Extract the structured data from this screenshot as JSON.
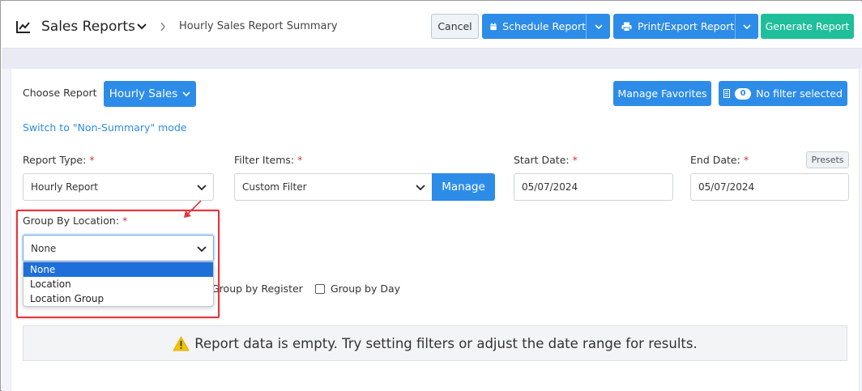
{
  "header": {
    "title": "Sales Reports",
    "breadcrumb": "Hourly Sales Report Summary",
    "cancel_label": "Cancel",
    "schedule_label": "Schedule Report",
    "print_label": "Print/Export Report",
    "generate_label": "Generate Report"
  },
  "toolbar": {
    "choose_label": "Choose Report",
    "report_button": "Hourly Sales",
    "favorites_button": "Manage Favorites",
    "filter_count": "0",
    "filter_label": "No filter selected",
    "mode_link": "Switch to \"Non-Summary\" mode"
  },
  "form": {
    "report_type": {
      "label": "Report Type:",
      "required": "*",
      "value": "Hourly Report"
    },
    "filter_items": {
      "label": "Filter Items:",
      "required": "*",
      "value": "Custom Filter",
      "manage_label": "Manage"
    },
    "start_date": {
      "label": "Start Date:",
      "required": "*",
      "value": "05/07/2024"
    },
    "end_date": {
      "label": "End Date:",
      "required": "*",
      "value": "05/07/2024"
    },
    "presets_label": "Presets",
    "group_by_location": {
      "label": "Group By Location:",
      "required": "*",
      "value": "None",
      "options": [
        "None",
        "Location",
        "Location Group"
      ]
    },
    "checkboxes": {
      "group_by_register": "Group by Register",
      "group_by_day": "Group by Day"
    }
  },
  "empty_message": "Report data is empty. Try setting filters or adjust the date range for results.",
  "colors": {
    "primary": "#2d8ce8",
    "success": "#1fbf9b",
    "highlight": "#e0353d",
    "required": "#d9303a"
  },
  "icons": {
    "header": "chart-line-icon",
    "schedule": "calendar-icon",
    "print": "printer-icon",
    "warning": "warning-icon"
  }
}
